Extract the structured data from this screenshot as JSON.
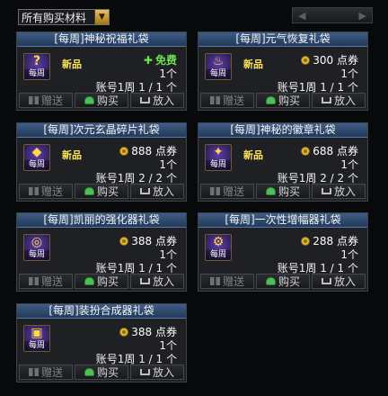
{
  "filter": {
    "value": "所有购买材料",
    "arrow": "▼"
  },
  "pager": {
    "prev": "◀",
    "next": "▶"
  },
  "buttons": {
    "gift": "赠送",
    "buy": "购买",
    "put": "放入"
  },
  "cards": [
    {
      "title": "[每周]神秘祝福礼袋",
      "icon_symbol": "?",
      "icon_tag": "每周",
      "badge": "新品",
      "price": "免费",
      "free": true,
      "qty": "1个",
      "limit": "账号1周 1 / 1 个"
    },
    {
      "title": "[每周]元气恢复礼袋",
      "icon_symbol": "♨",
      "icon_tag": "每周",
      "badge": "新品",
      "price": "300 点券",
      "free": false,
      "qty": "1个",
      "limit": "账号1周 1 / 1 个"
    },
    {
      "title": "[每周]次元玄晶碎片礼袋",
      "icon_symbol": "◆",
      "icon_tag": "每周",
      "badge": "新品",
      "price": "888 点券",
      "free": false,
      "qty": "1个",
      "limit": "账号1周 2 / 2 个"
    },
    {
      "title": "[每周]神秘的徽章礼袋",
      "icon_symbol": "✦",
      "icon_tag": "每周",
      "badge": "新品",
      "price": "688 点券",
      "free": false,
      "qty": "1个",
      "limit": "账号1周 2 / 2 个"
    },
    {
      "title": "[每周]凯丽的强化器礼袋",
      "icon_symbol": "◎",
      "icon_tag": "每周",
      "badge": "",
      "price": "388 点券",
      "free": false,
      "qty": "1个",
      "limit": "账号1周 1 / 1 个"
    },
    {
      "title": "[每周]一次性增幅器礼袋",
      "icon_symbol": "⚙",
      "icon_tag": "每周",
      "badge": "",
      "price": "288 点券",
      "free": false,
      "qty": "1个",
      "limit": "账号1周 1 / 1 个"
    },
    {
      "title": "[每周]装扮合成器礼袋",
      "icon_symbol": "▣",
      "icon_tag": "每周",
      "badge": "",
      "price": "388 点券",
      "free": false,
      "qty": "1个",
      "limit": "账号1周 1 / 1 个"
    }
  ]
}
